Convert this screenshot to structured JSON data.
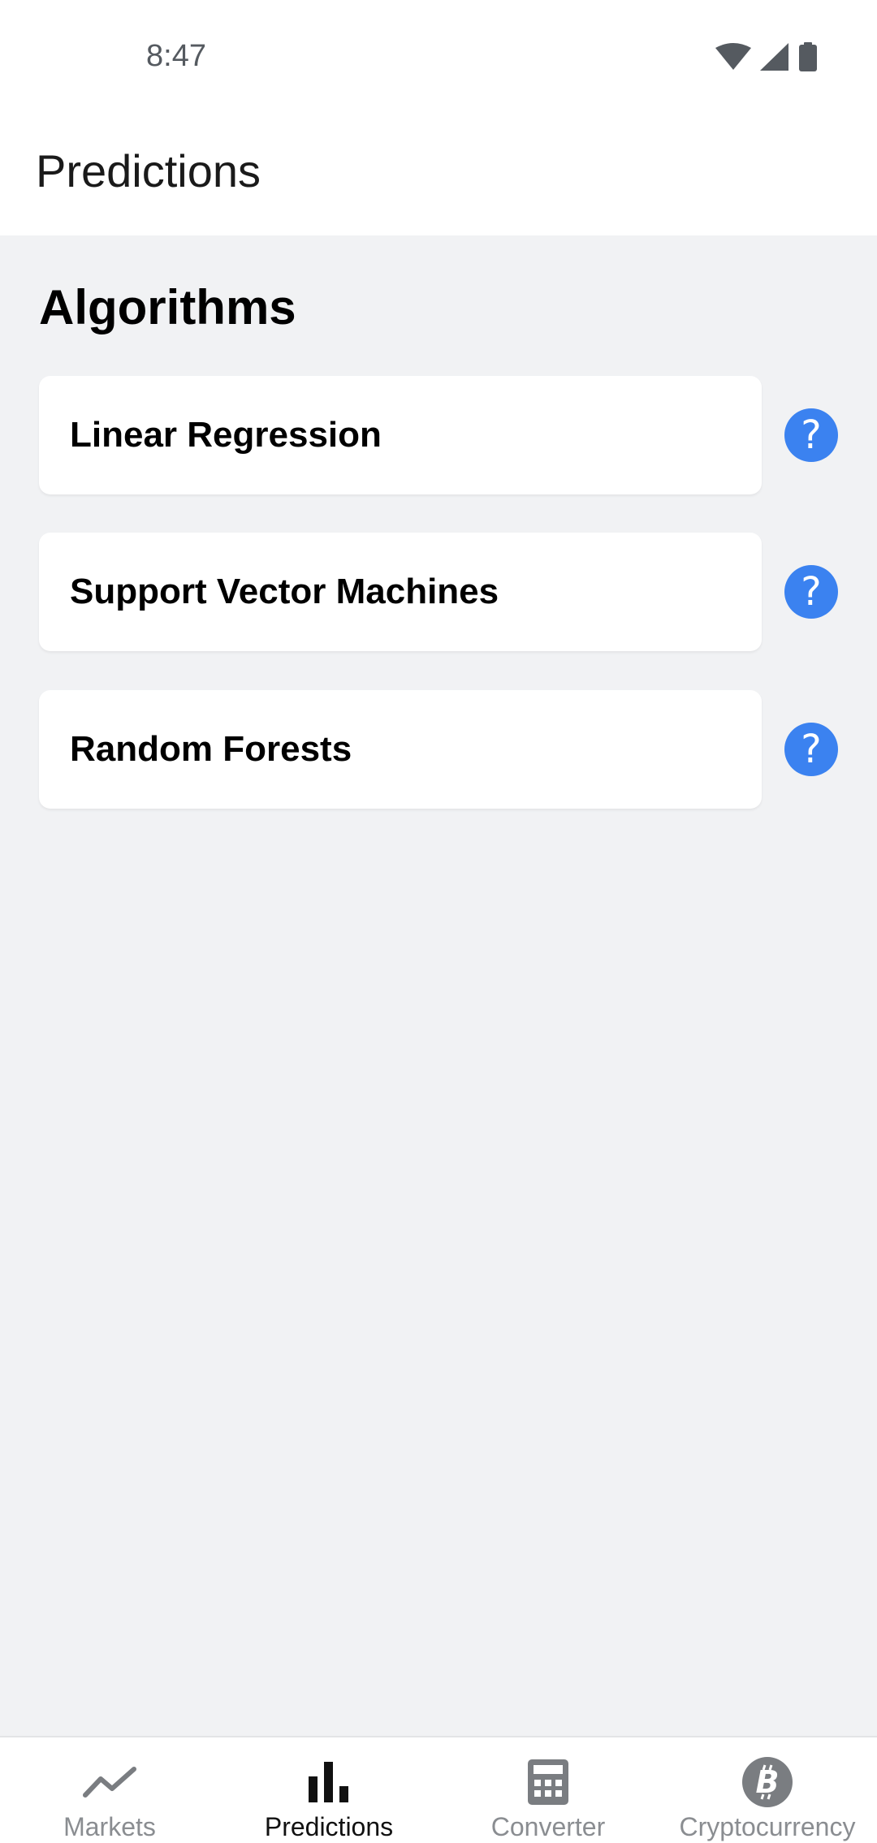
{
  "status_bar": {
    "time": "8:47",
    "icons": [
      "wifi-icon",
      "cell-signal-icon",
      "battery-icon"
    ]
  },
  "app_bar": {
    "title": "Predictions"
  },
  "main": {
    "section_title": "Algorithms",
    "algorithms": [
      {
        "label": "Linear Regression",
        "help_icon": "question-icon",
        "help_glyph": "?"
      },
      {
        "label": "Support Vector Machines",
        "help_icon": "question-icon",
        "help_glyph": "?"
      },
      {
        "label": "Random Forests",
        "help_icon": "question-icon",
        "help_glyph": "?"
      }
    ]
  },
  "bottom_nav": {
    "items": [
      {
        "label": "Markets",
        "icon": "trending-line-icon",
        "active": false
      },
      {
        "label": "Predictions",
        "icon": "bar-chart-icon",
        "active": true
      },
      {
        "label": "Converter",
        "icon": "calculator-icon",
        "active": false
      },
      {
        "label": "Cryptocurrency",
        "icon": "bitcoin-icon",
        "active": false
      }
    ]
  },
  "colors": {
    "accent": "#3b82f0",
    "background": "#f1f2f4",
    "card": "#ffffff",
    "nav_inactive": "#8a8d91",
    "nav_active": "#111111"
  }
}
